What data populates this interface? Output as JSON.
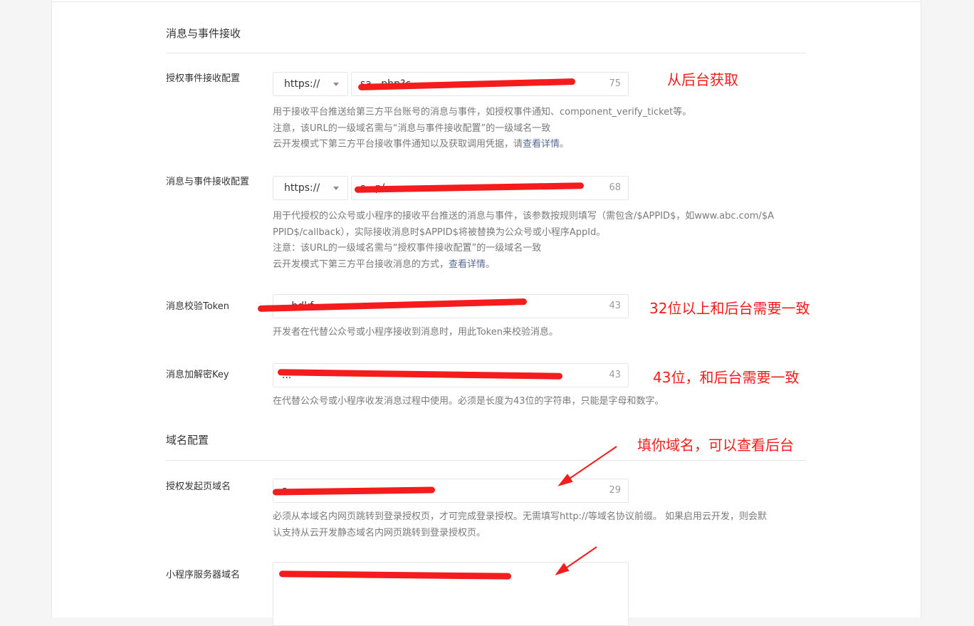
{
  "sections": {
    "message": "消息与事件接收",
    "domain": "域名配置"
  },
  "rows": {
    "auth_event": {
      "label": "授权事件接收配置",
      "protocol": "https://",
      "value": "sa...php?c",
      "count": "75",
      "desc": [
        "用于接收平台推送给第三方平台账号的消息与事件，如授权事件通知、component_verify_ticket等。",
        "注意，该URL的一级域名需与“消息与事件接收配置”的一级域名一致"
      ],
      "desc3_prefix": "云开发模式下第三方平台接收事件通知以及获取调用凭据，请",
      "desc3_link": "查看详情",
      "desc3_suffix": "。"
    },
    "msg_event": {
      "label": "消息与事件接收配置",
      "protocol": "https://",
      "value": "s...p/",
      "count": "68",
      "desc": [
        "用于代授权的公众号或小程序的接收平台推送的消息与事件，该参数按规则填写（需包含/$APPID$，如www.abc.com/$A",
        "PPID$/callback），实际接收消息时$APPID$将被替换为公众号或小程序AppId。",
        "注意：该URL的一级域名需与“授权事件接收配置”的一级域名一致"
      ],
      "desc4_prefix": "云开发模式下第三方平台接收消息的方式，",
      "desc4_link": "查看详情",
      "desc4_suffix": "。"
    },
    "token": {
      "label": "消息校验Token",
      "value": "...bdkf",
      "count": "43",
      "desc": "开发者在代替公众号或小程序接收到消息时，用此Token来校验消息。"
    },
    "key": {
      "label": "消息加解密Key",
      "value": "...",
      "count": "43",
      "desc": "在代替公众号或小程序收发消息过程中使用。必须是长度为43位的字符串，只能是字母和数字。"
    },
    "auth_domain": {
      "label": "授权发起页域名",
      "value": "s...",
      "count": "29",
      "desc": [
        "必须从本域名内网页跳转到登录授权页，才可完成登录授权。无需填写http://等域名协议前缀。 如果启用云开发，则会默",
        "认支持从云开发静态域名内网页跳转到登录授权页。"
      ]
    },
    "mp_domain": {
      "label": "小程序服务器域名",
      "value": "..."
    }
  },
  "annotations": {
    "from_backend": "从后台获取",
    "token_note": "32位以上和后台需要一致",
    "key_note": "43位，和后台需要一致",
    "domain_note": "填你域名，可以查看后台"
  },
  "colors": {
    "annotation": "#f41c1c",
    "link": "#576b95",
    "border": "#e4e8eb"
  }
}
